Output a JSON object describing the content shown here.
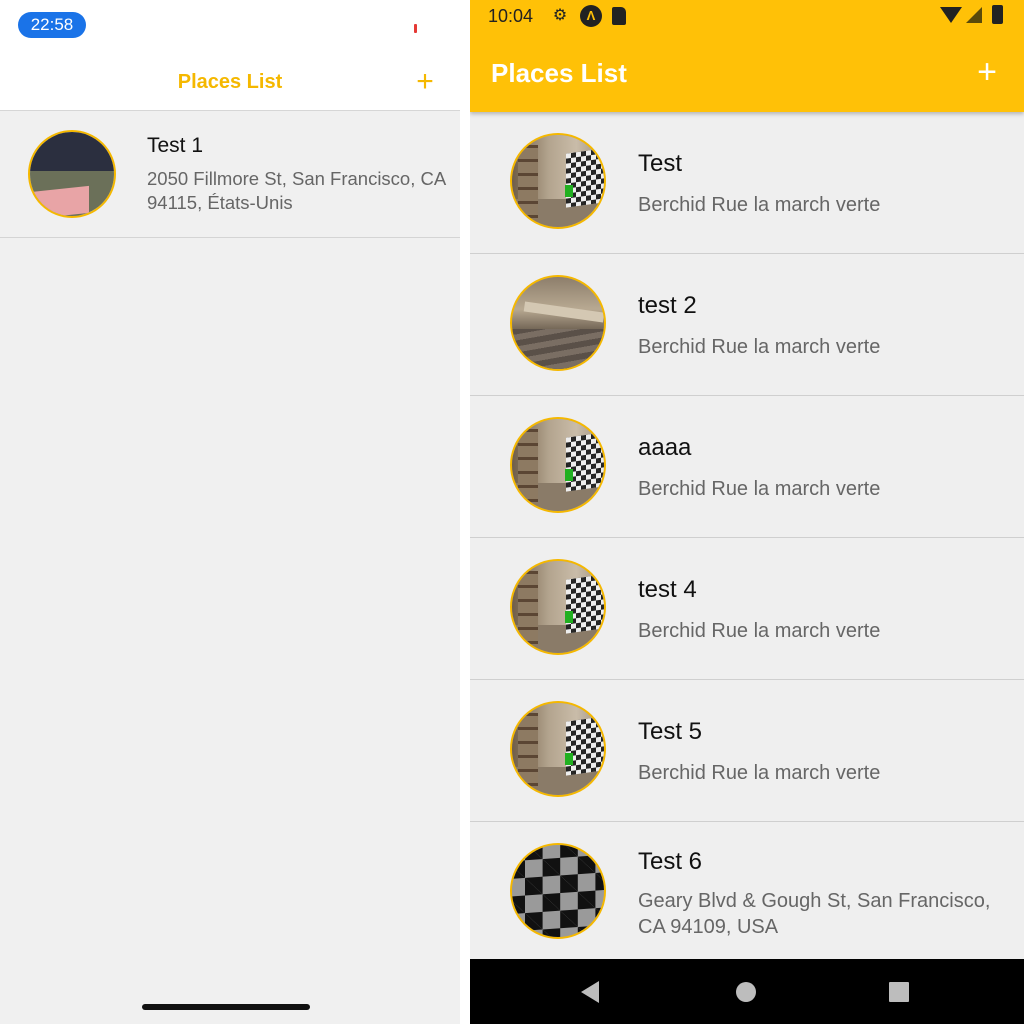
{
  "ios": {
    "status_time": "22:58",
    "header": {
      "title": "Places List",
      "add_label": "+"
    },
    "places": [
      {
        "title": "Test 1",
        "address": "2050 Fillmore St, San Francisco, CA 94115, États-Unis"
      }
    ]
  },
  "android": {
    "status_time": "10:04",
    "status_icons": [
      "gear-icon",
      "app-logo-icon",
      "sd-card-icon",
      "wifi-icon",
      "signal-icon",
      "battery-icon"
    ],
    "app_bar": {
      "title": "Places List",
      "add_label": "+",
      "color": "#ffc107"
    },
    "places": [
      {
        "title": "Test",
        "address": "Berchid Rue la march verte",
        "image": "room-photo"
      },
      {
        "title": "test 2",
        "address": "Berchid Rue la march verte",
        "image": "floor-photo"
      },
      {
        "title": "aaaa",
        "address": "Berchid Rue la march verte",
        "image": "room-photo"
      },
      {
        "title": "test 4",
        "address": "Berchid Rue la march verte",
        "image": "room-photo"
      },
      {
        "title": "Test 5",
        "address": "Berchid Rue la march verte",
        "image": "room-photo"
      },
      {
        "title": "Test 6",
        "address": "Geary Blvd & Gough St, San Francisco, CA 94109, USA",
        "image": "checkerboard-photo"
      }
    ],
    "nav_bar": [
      "back-icon",
      "home-icon",
      "recents-icon"
    ]
  },
  "colors": {
    "accent": "#f5b800",
    "android_app_bar": "#ffc107",
    "list_background": "#f0f0f0"
  }
}
